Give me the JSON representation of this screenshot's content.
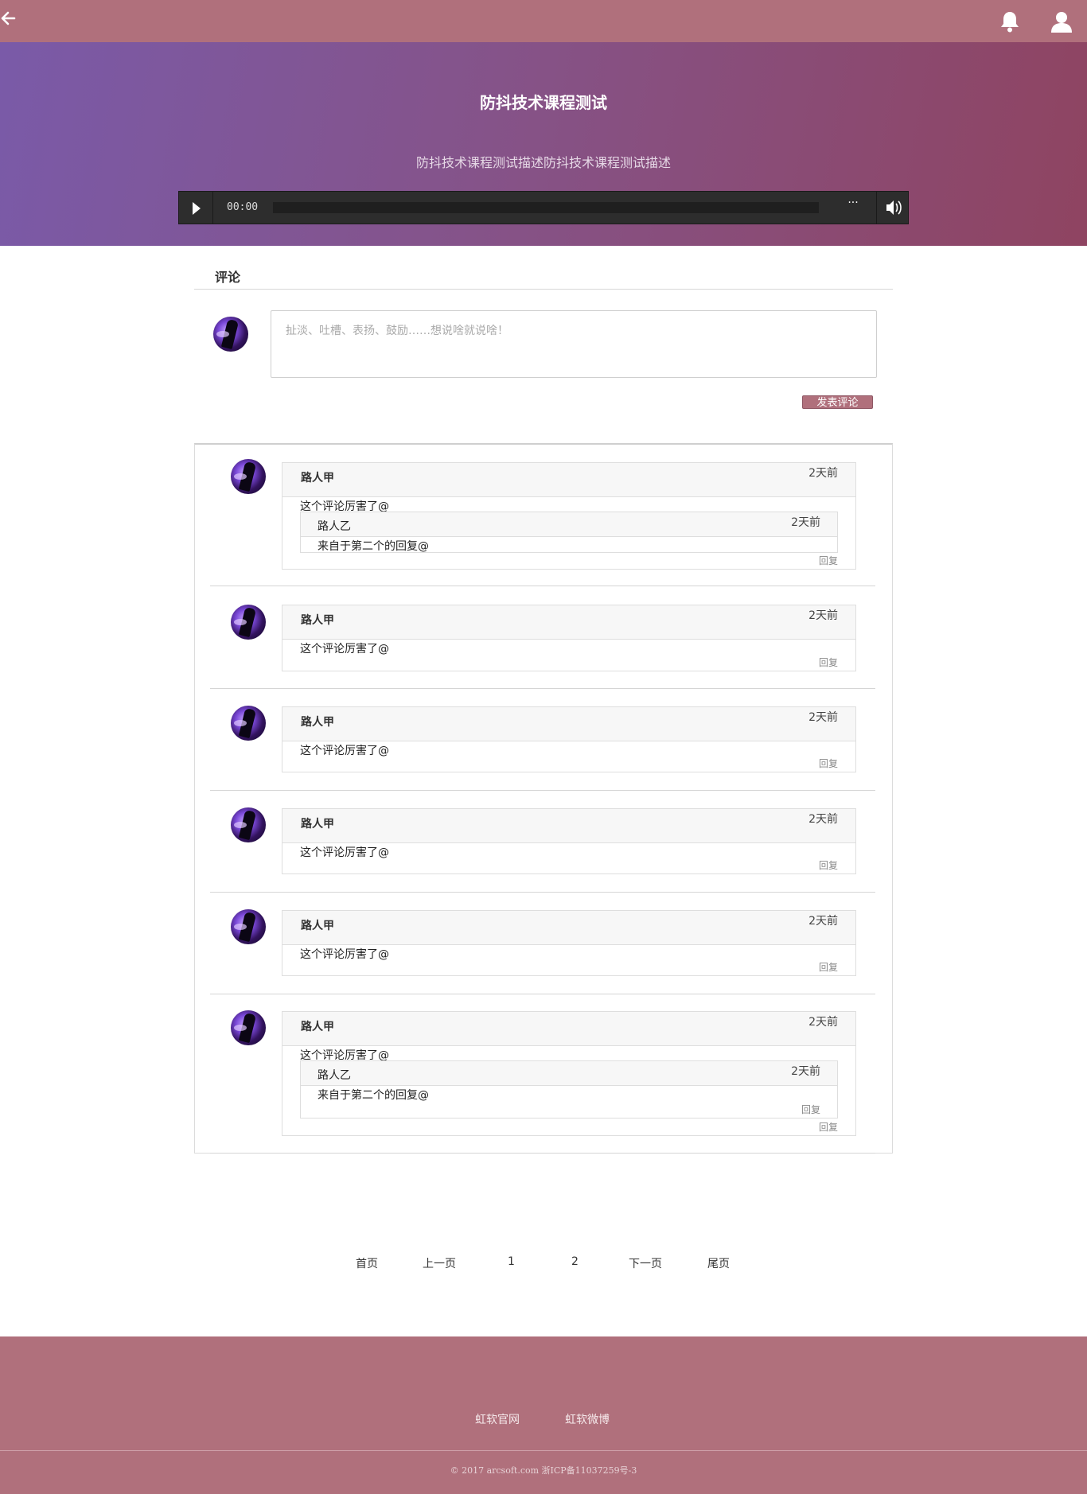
{
  "header": {
    "back_icon": "arrow-left-icon",
    "bell_icon": "bell-icon",
    "user_icon": "user-icon"
  },
  "hero": {
    "title": "防抖技术课程测试",
    "description": "防抖技术课程测试描述防抖技术课程测试描述",
    "player": {
      "time": "00:00",
      "more": "···"
    }
  },
  "comments_section": {
    "title": "评论",
    "input_placeholder": "扯淡、吐槽、表扬、鼓励……想说啥就说啥！",
    "submit_label": "发表评论"
  },
  "comments": [
    {
      "name": "路人甲",
      "time": "2天前",
      "text": "这个评论厉害了@",
      "reply": "回复",
      "sub": {
        "name": "路人乙",
        "time": "2天前",
        "text": "来自于第二个的回复@",
        "reply": ""
      }
    },
    {
      "name": "路人甲",
      "time": "2天前",
      "text": "这个评论厉害了@",
      "reply": "回复"
    },
    {
      "name": "路人甲",
      "time": "2天前",
      "text": "这个评论厉害了@",
      "reply": "回复"
    },
    {
      "name": "路人甲",
      "time": "2天前",
      "text": "这个评论厉害了@",
      "reply": "回复"
    },
    {
      "name": "路人甲",
      "time": "2天前",
      "text": "这个评论厉害了@",
      "reply": "回复"
    },
    {
      "name": "路人甲",
      "time": "2天前",
      "text": "这个评论厉害了@",
      "reply": "回复",
      "sub": {
        "name": "路人乙",
        "time": "2天前",
        "text": "来自于第二个的回复@",
        "reply": "回复"
      }
    }
  ],
  "pagination": {
    "first": "首页",
    "prev": "上一页",
    "page1": "1",
    "page2": "2",
    "next": "下一页",
    "last": "尾页"
  },
  "footer": {
    "link1": "虹软官网",
    "link2": "虹软微博",
    "copyright": "© 2017 arcsoft.com  浙ICP备11037259号-3"
  },
  "colors": {
    "brand": "#b0707c",
    "hero_start": "#7a5aa8",
    "hero_end": "#8f4461"
  }
}
